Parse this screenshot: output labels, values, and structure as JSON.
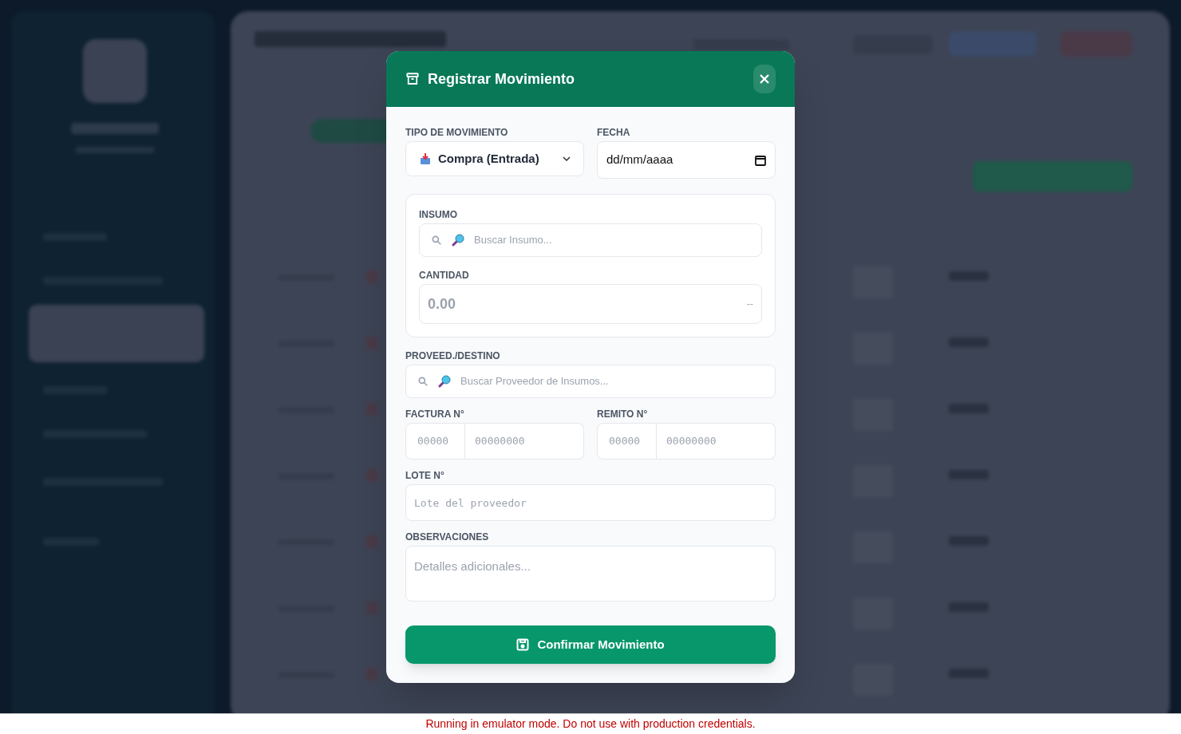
{
  "modal": {
    "title": "Registrar Movimiento",
    "fields": {
      "tipo": {
        "label": "TIPO DE MOVIMIENTO",
        "value": "Compra (Entrada)"
      },
      "fecha": {
        "label": "FECHA",
        "value": "dd/mm/aaaa"
      },
      "insumo": {
        "label": "INSUMO",
        "placeholder": "Buscar Insumo..."
      },
      "cantidad": {
        "label": "CANTIDAD",
        "placeholder": "0.00",
        "unit": "--"
      },
      "proveedor": {
        "label": "PROVEED./DESTINO",
        "placeholder": "Buscar Proveedor de Insumos..."
      },
      "factura": {
        "label": "FACTURA N°",
        "prefix_placeholder": "00000",
        "number_placeholder": "00000000"
      },
      "remito": {
        "label": "REMITO N°",
        "prefix_placeholder": "00000",
        "number_placeholder": "00000000"
      },
      "lote": {
        "label": "LOTE N°",
        "placeholder": "Lote del proveedor"
      },
      "observaciones": {
        "label": "OBSERVACIONES",
        "placeholder": "Detalles adicionales..."
      }
    },
    "submit": "Confirmar Movimiento"
  },
  "banner": "Running in emulator mode. Do not use with production credentials."
}
